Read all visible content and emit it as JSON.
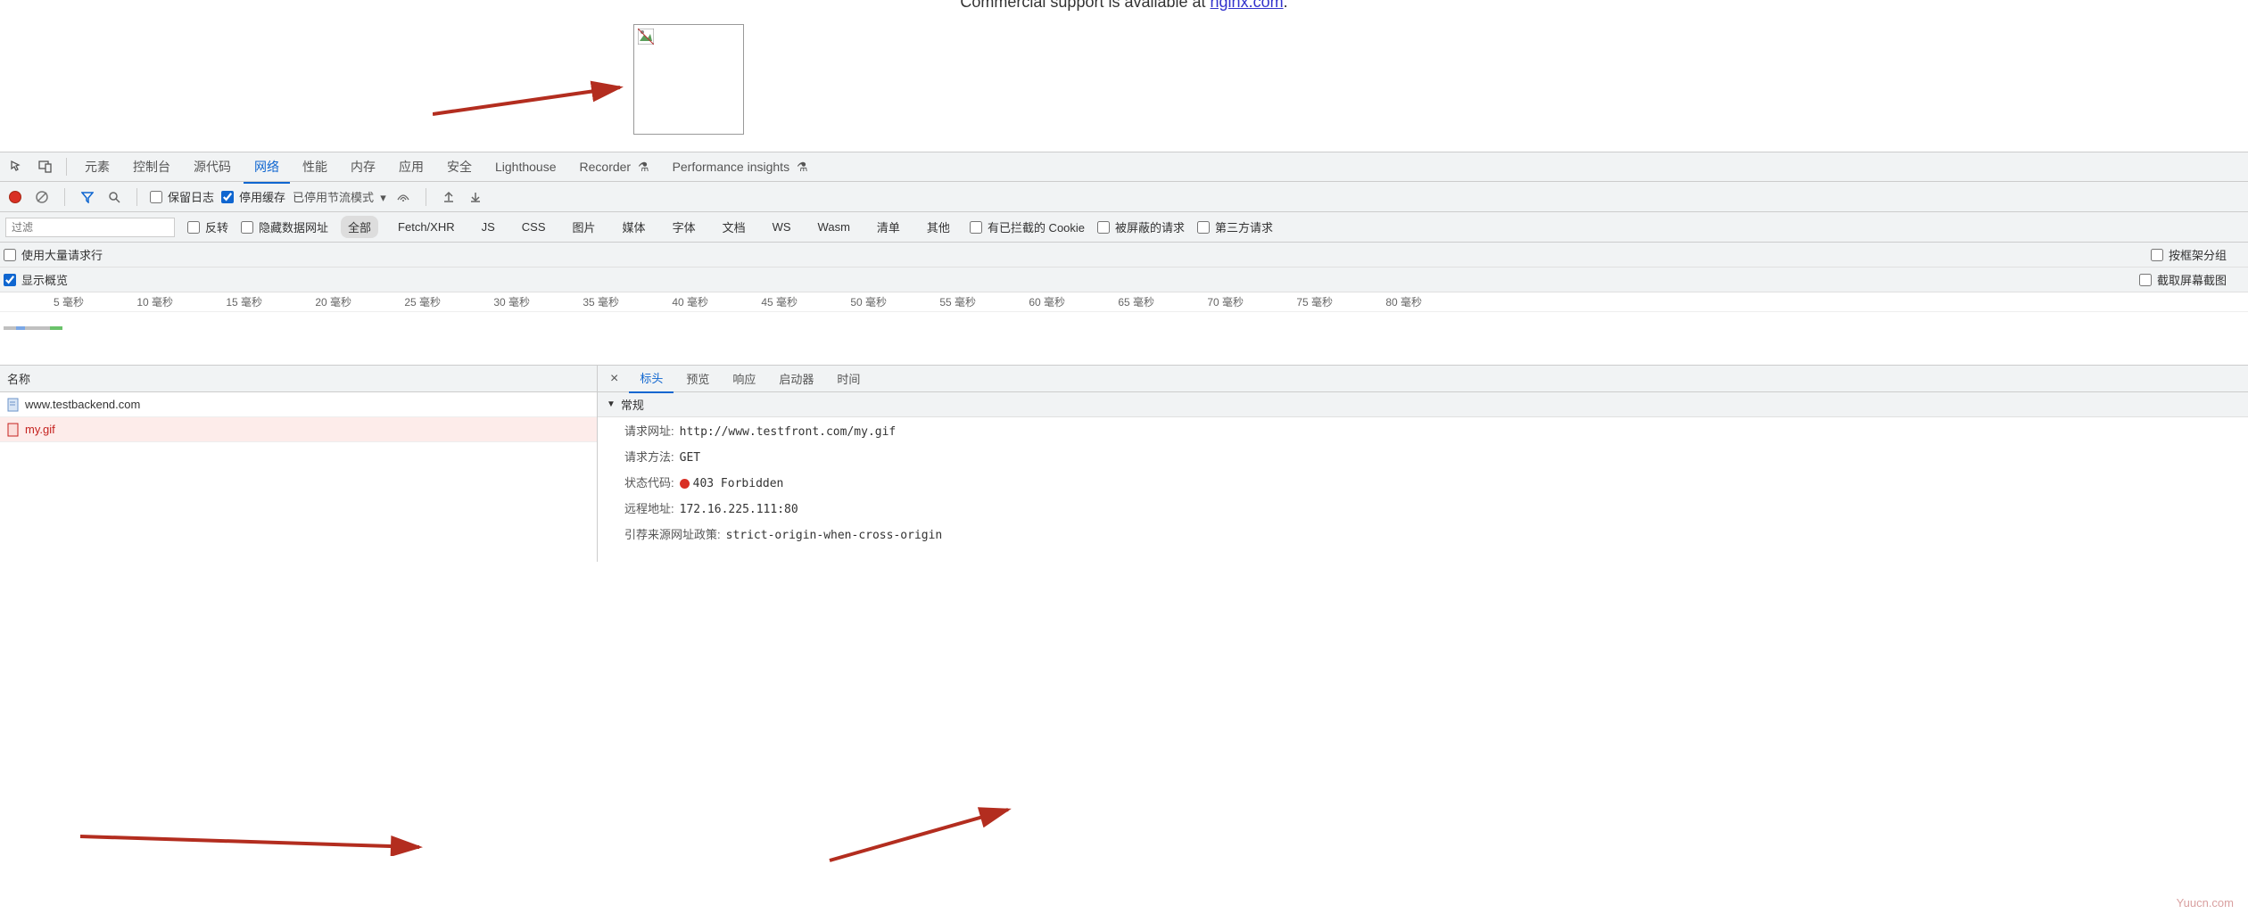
{
  "page": {
    "support_prefix": "Commercial support is available at ",
    "support_link": "nginx.com",
    "support_suffix": "."
  },
  "devtools": {
    "tabs": [
      "元素",
      "控制台",
      "源代码",
      "网络",
      "性能",
      "内存",
      "应用",
      "安全",
      "Lighthouse",
      "Recorder",
      "Performance insights"
    ],
    "active_tab": "网络"
  },
  "toolbar": {
    "preserve_log": "保留日志",
    "disable_cache": "停用缓存",
    "throttle": "已停用节流模式"
  },
  "filter": {
    "placeholder": "过滤",
    "invert": "反转",
    "hide_data_urls": "隐藏数据网址",
    "types": [
      "全部",
      "Fetch/XHR",
      "JS",
      "CSS",
      "图片",
      "媒体",
      "字体",
      "文档",
      "WS",
      "Wasm",
      "清单",
      "其他"
    ],
    "active_type": "全部",
    "blocked_cookies": "有已拦截的 Cookie",
    "blocked_requests": "被屏蔽的请求",
    "third_party": "第三方请求"
  },
  "opts": {
    "large_rows": "使用大量请求行",
    "group_by_frame": "按框架分组",
    "show_overview": "显示概览",
    "capture_screenshots": "截取屏幕截图"
  },
  "timeline": {
    "labels": [
      "5 毫秒",
      "10 毫秒",
      "15 毫秒",
      "20 毫秒",
      "25 毫秒",
      "30 毫秒",
      "35 毫秒",
      "40 毫秒",
      "45 毫秒",
      "50 毫秒",
      "55 毫秒",
      "60 毫秒",
      "65 毫秒",
      "70 毫秒",
      "75 毫秒",
      "80 毫秒"
    ]
  },
  "requests": {
    "name_header": "名称",
    "items": [
      {
        "name": "www.testbackend.com",
        "error": false
      },
      {
        "name": "my.gif",
        "error": true
      }
    ]
  },
  "details": {
    "tabs": [
      "标头",
      "预览",
      "响应",
      "启动器",
      "时间"
    ],
    "active": "标头",
    "section_general": "常规",
    "rows": [
      {
        "k": "请求网址:",
        "v": "http://www.testfront.com/my.gif"
      },
      {
        "k": "请求方法:",
        "v": "GET"
      },
      {
        "k": "状态代码:",
        "v": "403 Forbidden",
        "status": true
      },
      {
        "k": "远程地址:",
        "v": "172.16.225.111:80"
      },
      {
        "k": "引荐来源网址政策:",
        "v": "strict-origin-when-cross-origin"
      }
    ]
  },
  "watermark": "Yuucn.com"
}
